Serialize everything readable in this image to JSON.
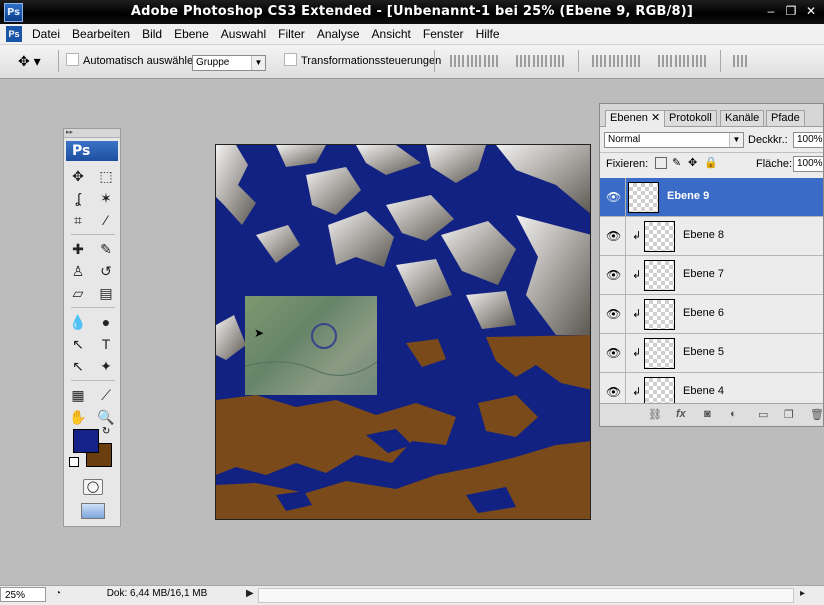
{
  "window": {
    "title": "Adobe Photoshop CS3 Extended - [Unbenannt-1 bei 25% (Ebene 9, RGB/8)]",
    "logo": "Ps"
  },
  "menu": [
    "Datei",
    "Bearbeiten",
    "Bild",
    "Ebene",
    "Auswahl",
    "Filter",
    "Analyse",
    "Ansicht",
    "Fenster",
    "Hilfe"
  ],
  "options": {
    "auto_select_label": "Automatisch auswählen:",
    "auto_select_value": "Gruppe",
    "transform_label": "Transformationssteuerungen"
  },
  "tools": {
    "header": "Ps",
    "items": [
      {
        "name": "move-tool-icon",
        "glyph": "✥"
      },
      {
        "name": "marquee-tool-icon",
        "glyph": "⬚"
      },
      {
        "name": "lasso-tool-icon",
        "glyph": "ʆ"
      },
      {
        "name": "magic-wand-tool-icon",
        "glyph": "✶"
      },
      {
        "name": "crop-tool-icon",
        "glyph": "⌗"
      },
      {
        "name": "slice-tool-icon",
        "glyph": "⁄"
      },
      {
        "name": "healing-brush-tool-icon",
        "glyph": "✚"
      },
      {
        "name": "brush-tool-icon",
        "glyph": "✎"
      },
      {
        "name": "clone-stamp-tool-icon",
        "glyph": "♙"
      },
      {
        "name": "history-brush-tool-icon",
        "glyph": "↺"
      },
      {
        "name": "eraser-tool-icon",
        "glyph": "▱"
      },
      {
        "name": "gradient-tool-icon",
        "glyph": "▤"
      },
      {
        "name": "blur-tool-icon",
        "glyph": "💧"
      },
      {
        "name": "dodge-tool-icon",
        "glyph": "●"
      },
      {
        "name": "path-selection-tool-icon",
        "glyph": "↖"
      },
      {
        "name": "type-tool-icon",
        "glyph": "T"
      },
      {
        "name": "direct-selection-tool-icon",
        "glyph": "↖"
      },
      {
        "name": "custom-shape-tool-icon",
        "glyph": "✦"
      },
      {
        "name": "notes-tool-icon",
        "glyph": "▦"
      },
      {
        "name": "eyedropper-tool-icon",
        "glyph": "⟋"
      },
      {
        "name": "hand-tool-icon",
        "glyph": "✋"
      },
      {
        "name": "zoom-tool-icon",
        "glyph": "🔍"
      }
    ],
    "foreground_color": "#14228a",
    "background_color": "#6b3e10"
  },
  "layers_panel": {
    "tabs": [
      {
        "label": "Ebenen",
        "active": true
      },
      {
        "label": "Protokoll",
        "active": false
      },
      {
        "label": "Kanäle",
        "active": false
      },
      {
        "label": "Pfade",
        "active": false
      }
    ],
    "blend_mode": "Normal",
    "opacity_label": "Deckkr.:",
    "opacity_value": "100%",
    "lock_label": "Fixieren:",
    "fill_label": "Fläche:",
    "fill_value": "100%",
    "layers": [
      {
        "name": "Ebene 9",
        "selected": true,
        "clipped": false
      },
      {
        "name": "Ebene 8",
        "selected": false,
        "clipped": true
      },
      {
        "name": "Ebene 7",
        "selected": false,
        "clipped": true
      },
      {
        "name": "Ebene 6",
        "selected": false,
        "clipped": true
      },
      {
        "name": "Ebene 5",
        "selected": false,
        "clipped": true
      },
      {
        "name": "Ebene 4",
        "selected": false,
        "clipped": true
      }
    ]
  },
  "status": {
    "zoom": "25%",
    "doc": "Dok: 6,44 MB/16,1 MB"
  },
  "colors": {
    "water": "#122282",
    "land": "#7a4a1a",
    "selection_accent": "#3a6bc6"
  }
}
